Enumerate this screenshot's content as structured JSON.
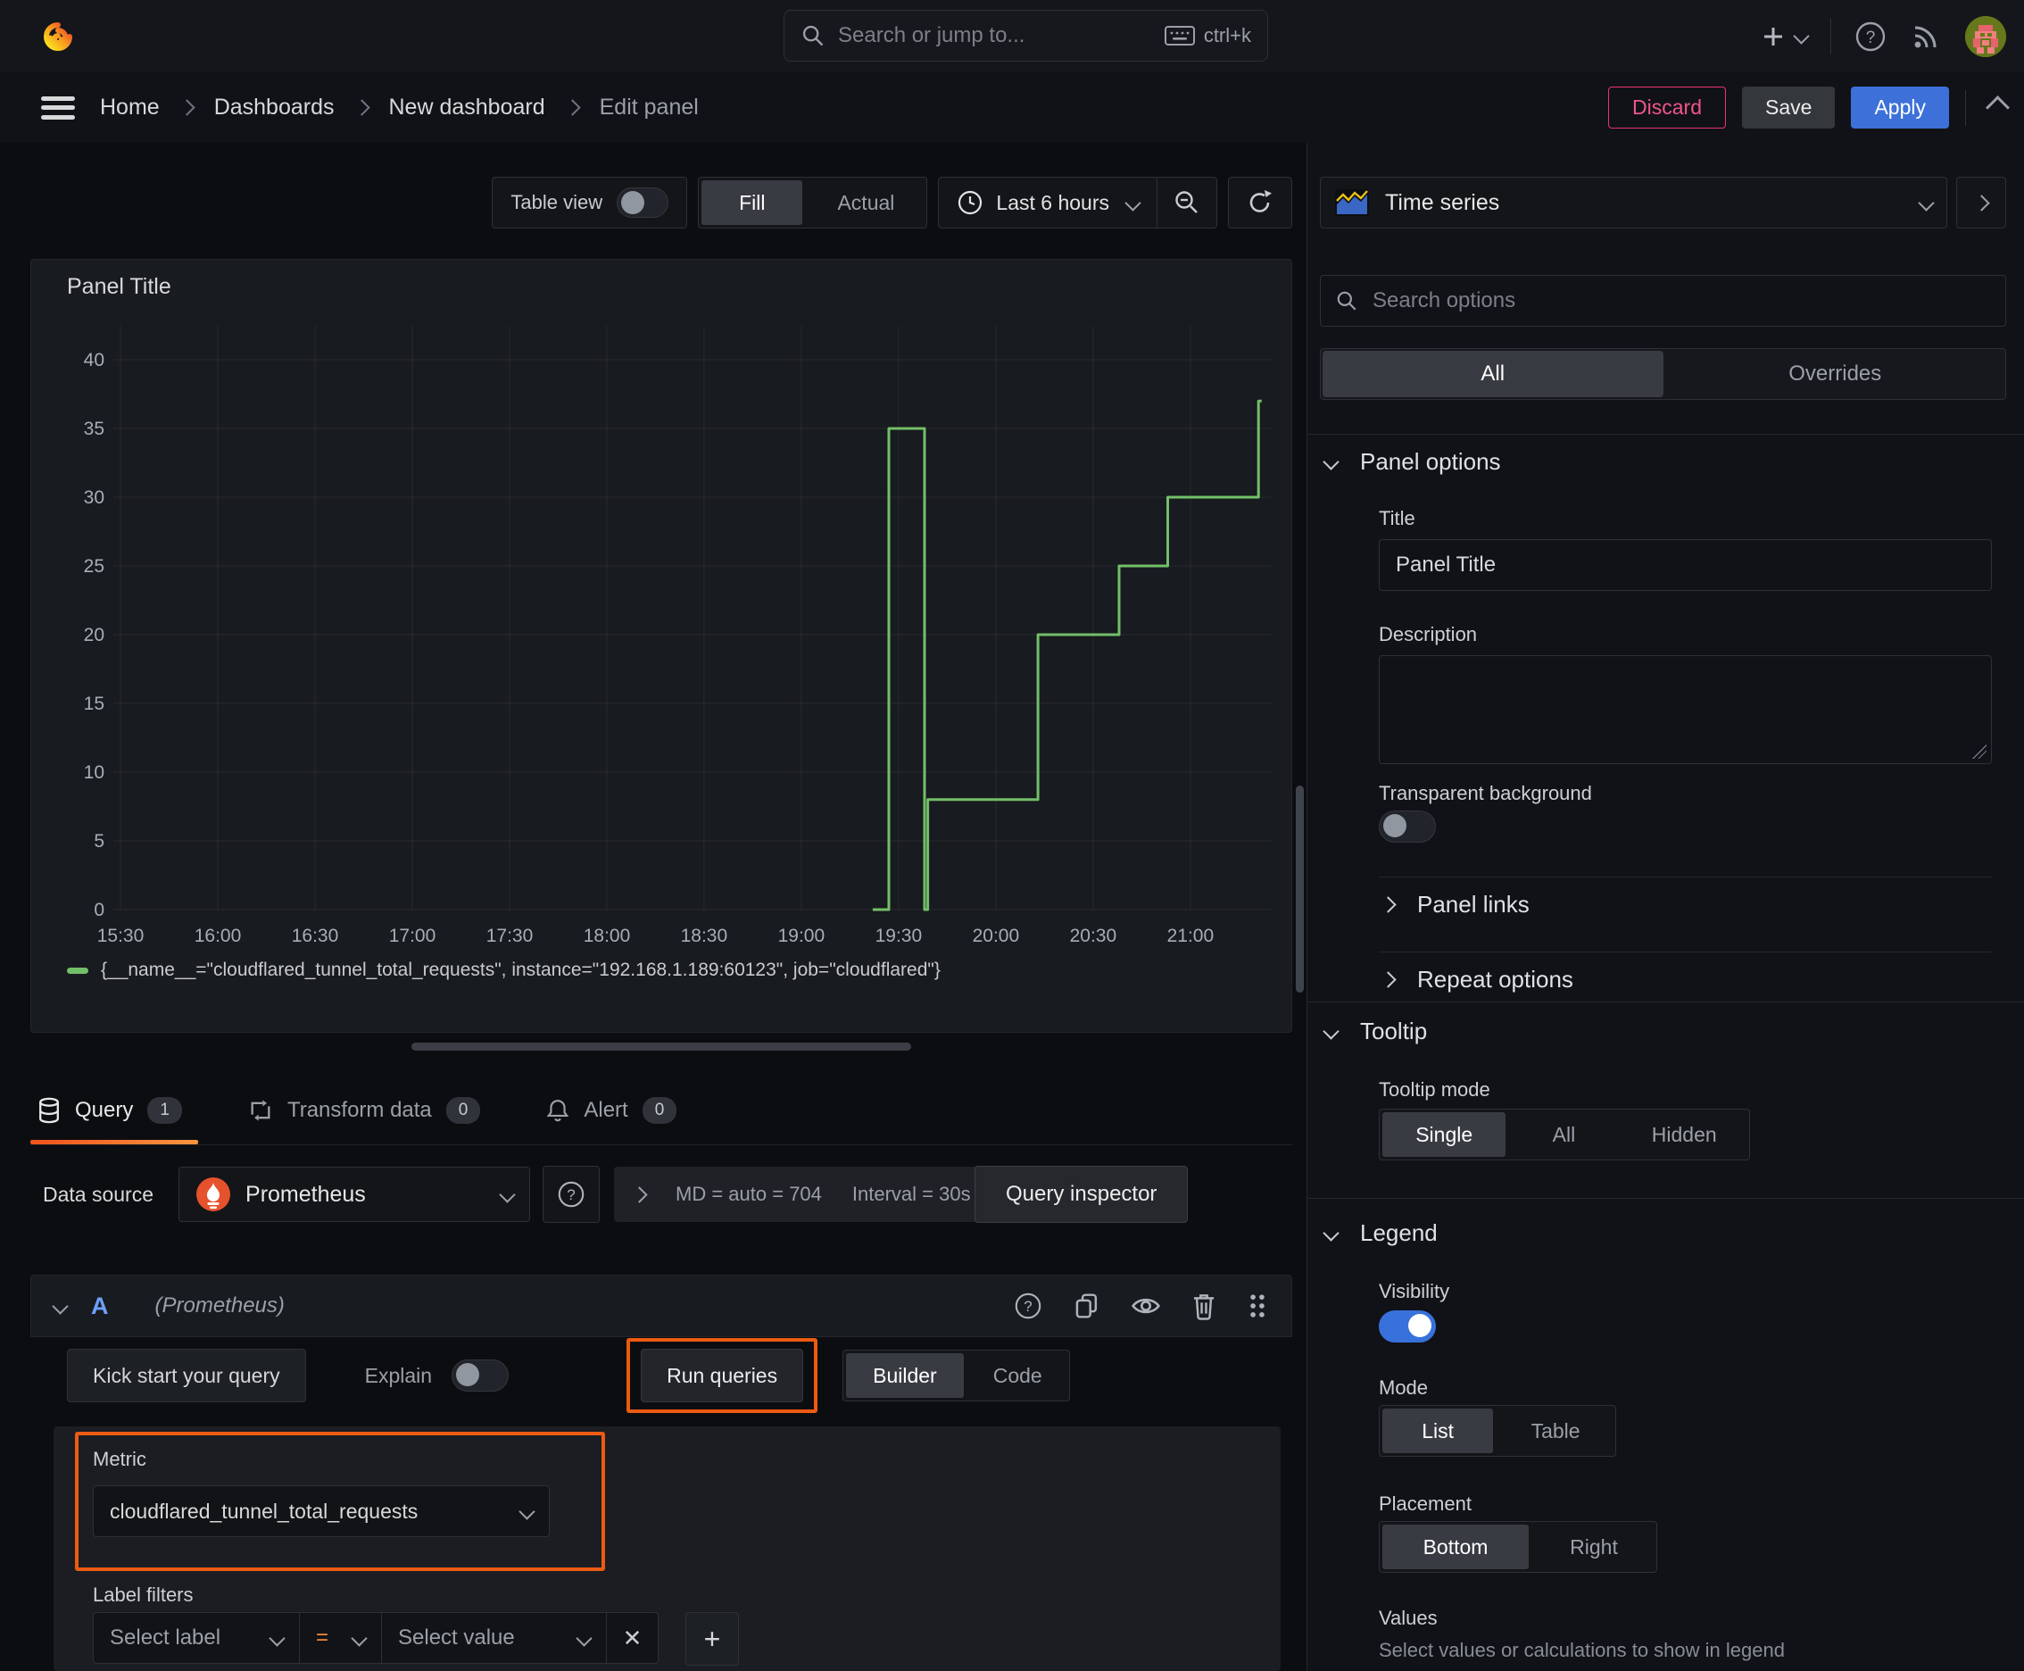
{
  "topbar": {
    "search_placeholder": "Search or jump to...",
    "shortcut": "ctrl+k"
  },
  "breadcrumb": {
    "items": [
      "Home",
      "Dashboards",
      "New dashboard",
      "Edit panel"
    ]
  },
  "actions": {
    "discard": "Discard",
    "save": "Save",
    "apply": "Apply"
  },
  "panel_toolbar": {
    "table_view": "Table view",
    "fill": "Fill",
    "actual": "Actual",
    "time_range": "Last 6 hours"
  },
  "viz_picker": {
    "name": "Time series"
  },
  "panel": {
    "title": "Panel Title"
  },
  "chart_data": {
    "type": "line",
    "subtype": "step-line",
    "title": "Panel Title",
    "xlabel": "",
    "ylabel": "",
    "ylim": [
      0,
      40
    ],
    "y_ticks": [
      0,
      5,
      10,
      15,
      20,
      25,
      30,
      35,
      40
    ],
    "x_ticks": [
      "15:30",
      "16:00",
      "16:30",
      "17:00",
      "17:30",
      "18:00",
      "18:30",
      "19:00",
      "19:30",
      "20:00",
      "20:30",
      "21:00"
    ],
    "x_tick_minutes": [
      0,
      30,
      60,
      90,
      120,
      150,
      180,
      210,
      240,
      270,
      300,
      330
    ],
    "grid": true,
    "legend_position": "bottom",
    "series": [
      {
        "name": "{__name__=\"cloudflared_tunnel_total_requests\", instance=\"192.168.1.189:60123\", job=\"cloudflared\"}",
        "color": "#73bf69",
        "points": [
          [
            232,
            0
          ],
          [
            237,
            0
          ],
          [
            237,
            35
          ],
          [
            248,
            35
          ],
          [
            248,
            0
          ],
          [
            249,
            0
          ],
          [
            249,
            8
          ],
          [
            283,
            8
          ],
          [
            283,
            20
          ],
          [
            308,
            20
          ],
          [
            308,
            25
          ],
          [
            323,
            25
          ],
          [
            323,
            30
          ],
          [
            351,
            30
          ],
          [
            351,
            37
          ],
          [
            352,
            37
          ]
        ]
      }
    ]
  },
  "tabs": [
    {
      "label": "Query",
      "count": "1"
    },
    {
      "label": "Transform data",
      "count": "0"
    },
    {
      "label": "Alert",
      "count": "0"
    }
  ],
  "datasource": {
    "label": "Data source",
    "value": "Prometheus",
    "md_stat": "MD = auto = 704",
    "interval_stat": "Interval = 30s",
    "inspector": "Query inspector"
  },
  "query": {
    "ref": "A",
    "ds_hint": "(Prometheus)",
    "kick_start": "Kick start your query",
    "explain": "Explain",
    "run": "Run queries",
    "builder": "Builder",
    "code": "Code",
    "metric_label": "Metric",
    "metric_value": "cloudflared_tunnel_total_requests",
    "label_filters": "Label filters",
    "select_label": "Select label",
    "operator": "=",
    "select_value": "Select value"
  },
  "options": {
    "search_placeholder": "Search options",
    "all": "All",
    "overrides": "Overrides",
    "panel_options": "Panel options",
    "title_label": "Title",
    "title_value": "Panel Title",
    "description_label": "Description",
    "transparent": "Transparent background",
    "panel_links": "Panel links",
    "repeat": "Repeat options",
    "tooltip": "Tooltip",
    "tooltip_mode": "Tooltip mode",
    "single": "Single",
    "tt_all": "All",
    "hidden": "Hidden",
    "legend": "Legend",
    "visibility": "Visibility",
    "mode": "Mode",
    "list": "List",
    "table": "Table",
    "placement": "Placement",
    "bottom": "Bottom",
    "right": "Right",
    "values": "Values",
    "values_hint": "Select values or calculations to show in legend"
  },
  "colors": {
    "accent_orange": "#ec5b13",
    "series_green": "#73bf69",
    "apply_blue": "#3d71d9",
    "discard_pink": "#e8336d",
    "toggle_blue": "#3871dc"
  }
}
